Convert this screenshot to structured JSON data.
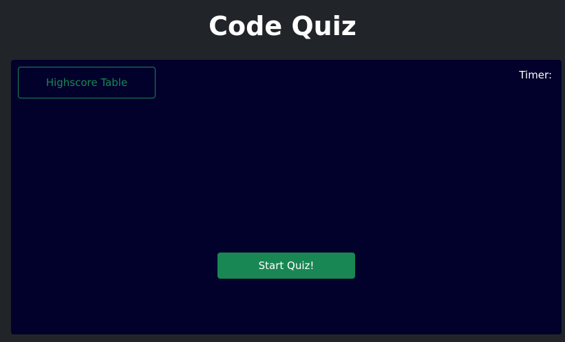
{
  "header": {
    "title": "Code Quiz"
  },
  "quiz": {
    "highscore_label": "Highscore Table",
    "timer_label": "Timer:",
    "timer_value": "",
    "start_label": "Start Quiz!"
  },
  "colors": {
    "page_background": "#212529",
    "panel_background": "#02012c",
    "accent_green": "#198754",
    "text_white": "#ffffff"
  }
}
